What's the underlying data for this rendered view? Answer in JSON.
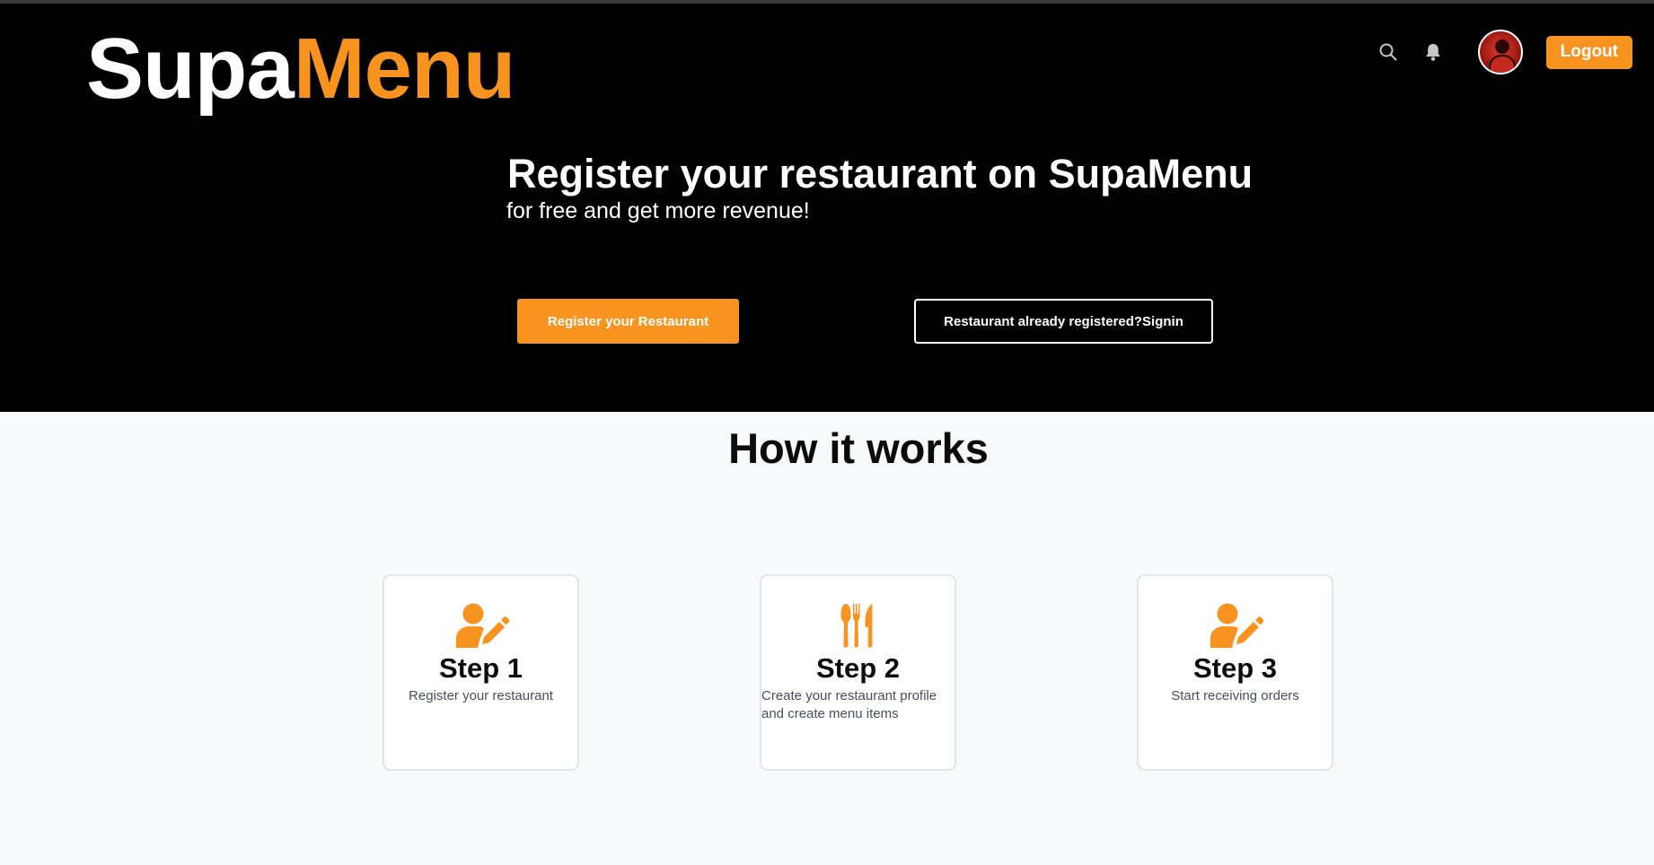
{
  "brand": {
    "part1": "Supa",
    "part2": "Menu"
  },
  "nav": {
    "search_icon": "search-icon",
    "bell_icon": "bell-icon",
    "avatar": "user-avatar",
    "logout_label": "Logout"
  },
  "hero": {
    "title": "Register your restaurant on SupaMenu",
    "subtitle": "for free and get more revenue!",
    "register_button": "Register your Restaurant",
    "signin_button": "Restaurant already registered?Signin"
  },
  "how_it_works": {
    "title": "How it works",
    "steps": [
      {
        "icon": "user-edit-icon",
        "title": "Step 1",
        "description": "Register your restaurant"
      },
      {
        "icon": "utensils-icon",
        "title": "Step 2",
        "description_line1": "Create your restaurant profile",
        "description_line2": "and create menu items"
      },
      {
        "icon": "user-edit-icon",
        "title": "Step 3",
        "description": "Start receiving orders"
      }
    ]
  },
  "colors": {
    "accent": "#f7931e",
    "hero_background": "#000000",
    "page_background": "#f8f9fb",
    "card_border": "#e1e4e8"
  }
}
